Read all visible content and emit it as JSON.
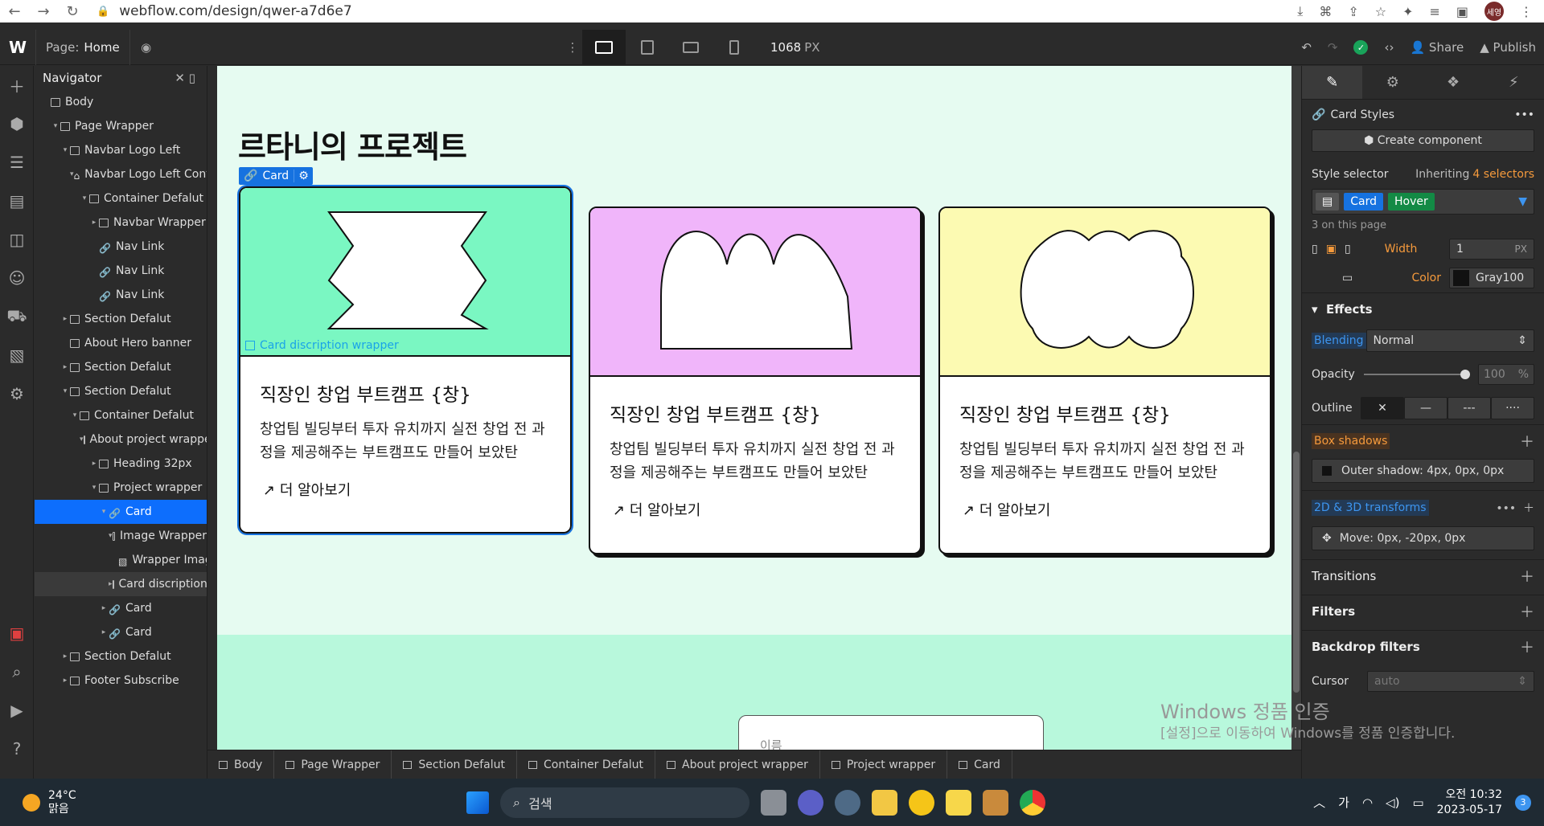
{
  "browser": {
    "url": "webflow.com/design/qwer-a7d6e7",
    "profile": "세영"
  },
  "topbar": {
    "page_label": "Page:",
    "page_name": "Home",
    "width_value": "1068",
    "width_unit": "PX",
    "share": "Share",
    "publish": "Publish"
  },
  "navigator": {
    "title": "Navigator",
    "nodes": [
      {
        "label": "Body",
        "depth": 0,
        "caret": "",
        "icon": "box"
      },
      {
        "label": "Page Wrapper",
        "depth": 1,
        "caret": "▾",
        "icon": "box"
      },
      {
        "label": "Navbar Logo Left",
        "depth": 2,
        "caret": "▾",
        "icon": "box"
      },
      {
        "label": "Navbar Logo Left Container",
        "depth": 3,
        "caret": "▾",
        "icon": "home"
      },
      {
        "label": "Container Defalut",
        "depth": 4,
        "caret": "▾",
        "icon": "box"
      },
      {
        "label": "Navbar Wrapper",
        "depth": 5,
        "caret": "▸",
        "icon": "box"
      },
      {
        "label": "Nav Link",
        "depth": 5,
        "caret": "",
        "icon": "link"
      },
      {
        "label": "Nav Link",
        "depth": 5,
        "caret": "",
        "icon": "link"
      },
      {
        "label": "Nav Link",
        "depth": 5,
        "caret": "",
        "icon": "link"
      },
      {
        "label": "Section Defalut",
        "depth": 2,
        "caret": "▸",
        "icon": "box"
      },
      {
        "label": "About Hero banner",
        "depth": 2,
        "caret": "",
        "icon": "box"
      },
      {
        "label": "Section Defalut",
        "depth": 2,
        "caret": "▸",
        "icon": "box"
      },
      {
        "label": "Section Defalut",
        "depth": 2,
        "caret": "▾",
        "icon": "box"
      },
      {
        "label": "Container Defalut",
        "depth": 3,
        "caret": "▾",
        "icon": "box"
      },
      {
        "label": "About project wrapper",
        "depth": 4,
        "caret": "▾",
        "icon": "box"
      },
      {
        "label": "Heading 32px",
        "depth": 5,
        "caret": "▸",
        "icon": "box"
      },
      {
        "label": "Project wrapper",
        "depth": 5,
        "caret": "▾",
        "icon": "box"
      },
      {
        "label": "Card",
        "depth": 6,
        "caret": "▾",
        "icon": "link",
        "state": "sel"
      },
      {
        "label": "Image Wrapper",
        "depth": 7,
        "caret": "▾",
        "icon": "box"
      },
      {
        "label": "Wrapper Image",
        "depth": 8,
        "caret": "",
        "icon": "image"
      },
      {
        "label": "Card discription wrapper",
        "depth": 7,
        "caret": "▸",
        "icon": "box",
        "state": "hl"
      },
      {
        "label": "Card",
        "depth": 6,
        "caret": "▸",
        "icon": "link"
      },
      {
        "label": "Card",
        "depth": 6,
        "caret": "▸",
        "icon": "link"
      },
      {
        "label": "Section Defalut",
        "depth": 2,
        "caret": "▸",
        "icon": "box"
      },
      {
        "label": "Footer Subscribe",
        "depth": 2,
        "caret": "▸",
        "icon": "box"
      }
    ]
  },
  "canvas": {
    "heading": "르타니의 프로젝트",
    "selected_tag": "Card",
    "desc_wrapper_label": "Card discription wrapper",
    "cards": [
      {
        "color": "#7af7c2",
        "shape": "bowtie",
        "title": "직장인 창업 부트캠프 {창}",
        "text_line1": "창업팀 빌딩부터 투자 유치까지 실전 창업 전 과",
        "text_line2": "정을 제공해주는 부트캠프도 만들어 보았탄",
        "more": "더 알아보기"
      },
      {
        "color": "#f0b5fa",
        "shape": "arch",
        "title": "직장인 창업 부트캠프 {창}",
        "text_line1": "창업팀 빌딩부터 투자 유치까지 실전 창업 전 과",
        "text_line2": "정을 제공해주는 부트캠프도 만들어 보았탄",
        "more": "더 알아보기"
      },
      {
        "color": "#fcfab2",
        "shape": "cloud",
        "title": "직장인 창업 부트캠프 {창}",
        "text_line1": "창업팀 빌딩부터 투자 유치까지 실전 창업 전 과",
        "text_line2": "정을 제공해주는 부트캠프도 만들어 보았탄",
        "more": "더 알아보기"
      }
    ],
    "form_placeholder": "이름",
    "watermark_title": "Windows 정품 인증",
    "watermark_sub": "[설정]으로 이동하여 Windows를 정품 인증합니다."
  },
  "breadcrumb": [
    "Body",
    "Page Wrapper",
    "Section Defalut",
    "Container Defalut",
    "About project wrapper",
    "Project wrapper",
    "Card"
  ],
  "style_panel": {
    "style_name": "Card Styles",
    "create_component": "Create component",
    "style_selector": "Style selector",
    "inheriting": "Inheriting",
    "selectors_count": "4 selectors",
    "sel_class": "Card",
    "sel_state": "Hover",
    "on_page": "3 on this page",
    "border_width_label": "Width",
    "border_width": "1",
    "border_width_unit": "PX",
    "border_color_label": "Color",
    "border_color": "Gray100",
    "effects": "Effects",
    "blending_label": "Blending",
    "blending_value": "Normal",
    "opacity_label": "Opacity",
    "opacity_value": "100",
    "opacity_unit": "%",
    "outline_label": "Outline",
    "box_shadows": "Box shadows",
    "shadow_value": "Outer shadow: 4px, 0px, 0px",
    "transforms": "2D & 3D transforms",
    "transform_value": "Move: 0px, -20px, 0px",
    "transitions": "Transitions",
    "filters": "Filters",
    "backdrop": "Backdrop filters",
    "cursor_label": "Cursor",
    "cursor_value": "auto"
  },
  "taskbar": {
    "temp": "24°C",
    "weather": "맑음",
    "search": "검색",
    "ime": "가",
    "time": "오전 10:32",
    "date": "2023-05-17",
    "notifications": "3"
  }
}
